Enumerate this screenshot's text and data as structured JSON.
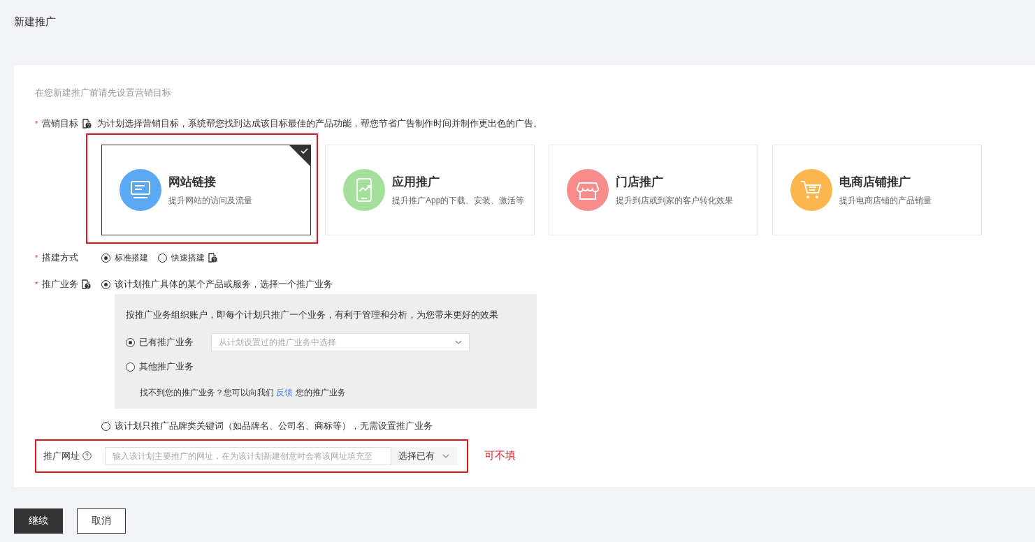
{
  "page_title": "新建推广",
  "intro": "在您新建推广前请先设置营销目标",
  "goal": {
    "label": "营销目标",
    "required_mark": "*",
    "hint": "为计划选择营销目标，系统帮您找到达成该目标最佳的产品功能，帮您节省广告制作时间并制作更出色的广告。",
    "cards": [
      {
        "kind": "website",
        "title": "网站链接",
        "desc": "提升网站的访问及流量",
        "selected": true,
        "annotated": true,
        "color": "#5ba8f5"
      },
      {
        "kind": "app",
        "title": "应用推广",
        "desc": "提升推广App的下载、安装、激活等",
        "selected": false,
        "annotated": false,
        "color": "#a3e09a"
      },
      {
        "kind": "store",
        "title": "门店推广",
        "desc": "提升到店或到家的客户转化效果",
        "selected": false,
        "annotated": false,
        "color": "#f88c8c"
      },
      {
        "kind": "shop",
        "title": "电商店铺推广",
        "desc": "提升电商店铺的产品销量",
        "selected": false,
        "annotated": false,
        "color": "#fdb54d"
      }
    ]
  },
  "build": {
    "label": "搭建方式",
    "required_mark": "*",
    "options": [
      {
        "label": "标准搭建",
        "selected": true,
        "help": false
      },
      {
        "label": "快速搭建",
        "selected": false,
        "help": true
      }
    ]
  },
  "business": {
    "label": "推广业务",
    "required_mark": "*",
    "options": [
      {
        "label": "该计划推广具体的某个产品或服务，选择一个推广业务",
        "selected": true
      },
      {
        "label": "该计划只推广品牌类关键词（如品牌名、公司名、商标等），无需设置推广业务",
        "selected": false
      }
    ],
    "detail": {
      "intro": "按推广业务组织账户，即每个计划只推广一个业务，有利于管理和分析，为您带来更好的效果",
      "choices": [
        {
          "label": "已有推广业务",
          "selected": true,
          "placeholder": "从计划设置过的推广业务中选择"
        },
        {
          "label": "其他推广业务",
          "selected": false
        }
      ],
      "feedback": {
        "before": "找不到您的推广业务？您可以向我们",
        "link": "反馈",
        "after": "您的推广业务"
      }
    }
  },
  "url": {
    "label": "推广网址",
    "placeholder": "输入该计划主要推广的网址，在为该计划新建创意时会将该网址填充至",
    "select": "选择已有",
    "note": "可不填"
  },
  "buttons": [
    {
      "kind": "primary",
      "label": "继续"
    },
    {
      "kind": "secondary",
      "label": "取消"
    }
  ]
}
